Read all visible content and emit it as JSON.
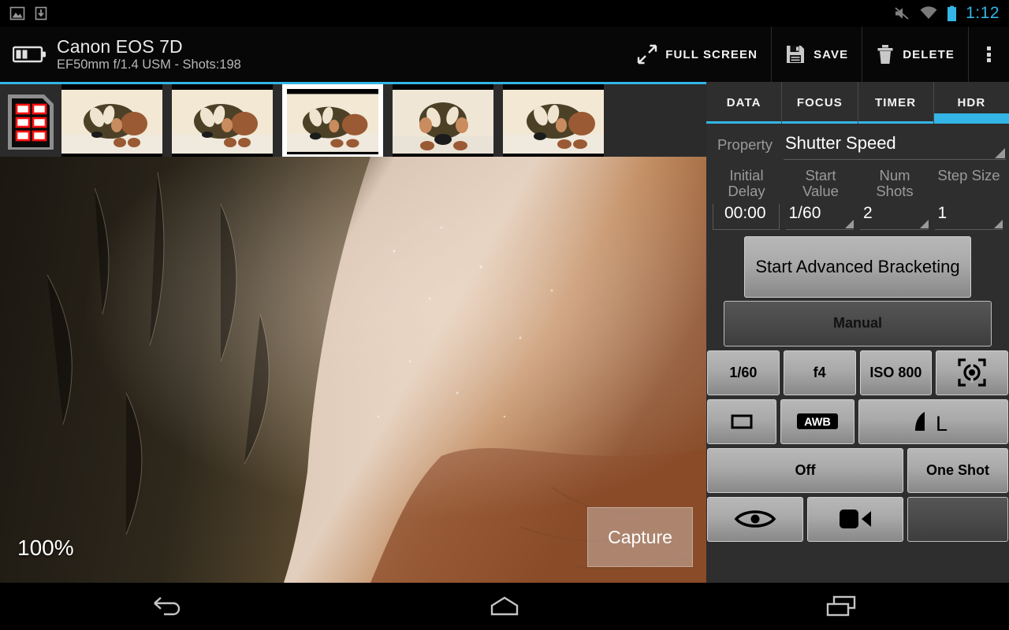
{
  "status_bar": {
    "icons": [
      "image-icon",
      "download-icon",
      "mute-icon",
      "wifi-icon",
      "battery-icon"
    ],
    "clock": "1:12",
    "clock_color": "#33b5e5"
  },
  "action_bar": {
    "battery_icon": "camera-battery-icon",
    "title": "Canon EOS 7D",
    "subtitle": "EF50mm f/1.4 USM - Shots:198",
    "actions": [
      {
        "label": "FULL SCREEN",
        "icon": "expand-icon"
      },
      {
        "label": "SAVE",
        "icon": "floppy-disk-icon"
      },
      {
        "label": "DELETE",
        "icon": "trash-icon"
      }
    ],
    "overflow_icon": "overflow-menu-icon"
  },
  "filmstrip": {
    "gallery_icon": "sd-card-gallery-icon",
    "thumbnails": [
      {
        "name": "thumbnail-1",
        "selected": false
      },
      {
        "name": "thumbnail-2",
        "selected": false
      },
      {
        "name": "thumbnail-3",
        "selected": true
      },
      {
        "name": "thumbnail-4",
        "selected": false
      },
      {
        "name": "thumbnail-5",
        "selected": false
      }
    ],
    "accent_color": "#33b5e5"
  },
  "preview": {
    "zoom_level": "100%",
    "capture_label": "Capture"
  },
  "panel": {
    "tabs": [
      {
        "label": "DATA",
        "active": false
      },
      {
        "label": "FOCUS",
        "active": false
      },
      {
        "label": "TIMER",
        "active": false
      },
      {
        "label": "HDR",
        "active": true
      }
    ],
    "property": {
      "label": "Property",
      "value": "Shutter Speed"
    },
    "bracketing_fields": [
      {
        "label_line1": "Initial",
        "label_line2": "Delay",
        "value": "00:00",
        "type": "edit"
      },
      {
        "label_line1": "Start",
        "label_line2": "Value",
        "value": "1/60",
        "type": "spinner"
      },
      {
        "label_line1": "Num",
        "label_line2": "Shots",
        "value": "2",
        "type": "spinner"
      },
      {
        "label_line1": "Step Size",
        "label_line2": "",
        "value": "1",
        "type": "spinner"
      }
    ],
    "start_button": "Start Advanced Bracketing",
    "mode_button": "Manual",
    "settings_row_1": [
      {
        "label": "1/60",
        "name": "shutter-speed-button"
      },
      {
        "label": "f4",
        "name": "aperture-button"
      },
      {
        "label": "ISO 800",
        "name": "iso-button"
      },
      {
        "label": "",
        "name": "metering-mode-button",
        "icon": "metering-mode-icon"
      }
    ],
    "settings_row_2": [
      {
        "label": "",
        "name": "exposure-button",
        "icon": "rectangle-icon"
      },
      {
        "label": "",
        "name": "white-balance-button",
        "icon": "awb-icon"
      },
      {
        "label": "",
        "name": "image-quality-button",
        "icon": "quality-large-icon"
      }
    ],
    "settings_row_3": [
      {
        "label": "Off",
        "name": "flash-mode-button"
      },
      {
        "label": "One Shot",
        "name": "drive-mode-button"
      }
    ],
    "settings_row_4": [
      {
        "label": "",
        "name": "live-view-button",
        "icon": "eye-icon"
      },
      {
        "label": "",
        "name": "video-record-button",
        "icon": "video-camera-icon"
      },
      {
        "label": "",
        "name": "empty-button",
        "icon": ""
      }
    ]
  },
  "nav_bar": {
    "buttons": [
      {
        "name": "nav-back-button",
        "icon": "back-arrow-icon"
      },
      {
        "name": "nav-home-button",
        "icon": "home-icon"
      },
      {
        "name": "nav-recents-button",
        "icon": "recents-icon"
      }
    ]
  }
}
